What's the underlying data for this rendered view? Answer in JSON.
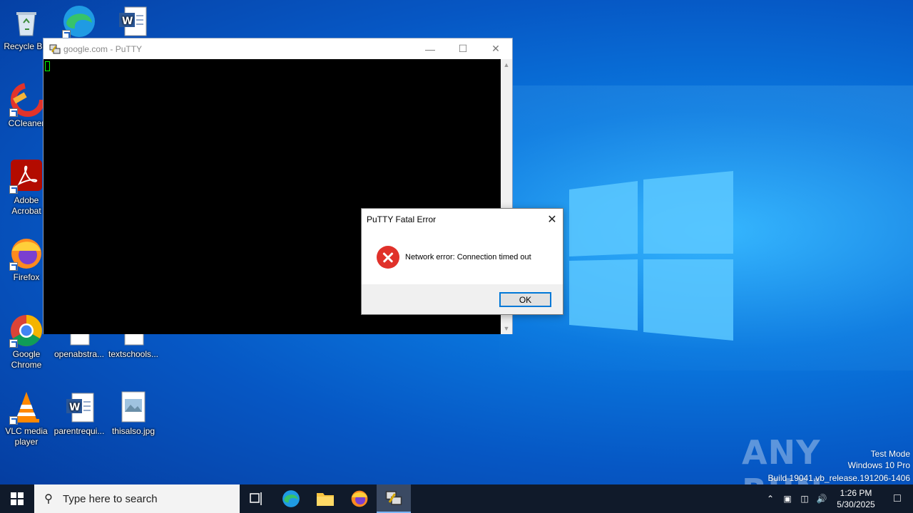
{
  "desktop": {
    "icons": [
      {
        "label": "Recycle Bin",
        "icon": "recycle-bin-icon"
      },
      {
        "label": "",
        "icon": "edge-icon"
      },
      {
        "label": "",
        "icon": "word-doc-icon"
      },
      {
        "label": "CCleaner",
        "icon": "ccleaner-icon"
      },
      {
        "label": "Adobe Acrobat",
        "icon": "acrobat-icon"
      },
      {
        "label": "Firefox",
        "icon": "firefox-icon"
      },
      {
        "label": "Google Chrome",
        "icon": "chrome-icon"
      },
      {
        "label": "openabstra...",
        "icon": "doc-icon"
      },
      {
        "label": "textschools...",
        "icon": "doc-icon"
      },
      {
        "label": "VLC media player",
        "icon": "vlc-icon"
      },
      {
        "label": "parentrequi...",
        "icon": "word-doc-icon"
      },
      {
        "label": "thisalso.jpg",
        "icon": "image-file-icon"
      }
    ]
  },
  "putty_window": {
    "title": "google.com - PuTTY"
  },
  "error_dialog": {
    "title": "PuTTY Fatal Error",
    "message": "Network error: Connection timed out",
    "ok_label": "OK"
  },
  "watermark": {
    "brand": "ANY RUN",
    "line1": "Test Mode",
    "line2": "Windows 10 Pro",
    "line3": "Build 19041.vb_release.191206-1406"
  },
  "taskbar": {
    "search_placeholder": "Type here to search",
    "time": "1:26 PM",
    "date": "5/30/2025",
    "accent": "#7cb7ff"
  }
}
